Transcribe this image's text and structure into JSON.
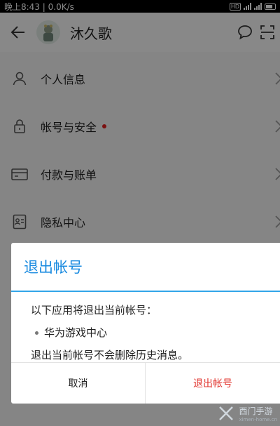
{
  "status_bar": {
    "time_net": "晚上8:43 | 0.0K/s",
    "hd_badge": "HD"
  },
  "app_bar": {
    "user_name": "沐久歌"
  },
  "menu": {
    "items": [
      {
        "label": "个人信息",
        "icon": "person-icon"
      },
      {
        "label": "帐号与安全",
        "icon": "lock-icon",
        "badge": "red-dot"
      },
      {
        "label": "付款与账单",
        "icon": "card-icon"
      },
      {
        "label": "隐私中心",
        "icon": "id-card-icon"
      }
    ]
  },
  "dialog": {
    "title": "退出帐号",
    "intro": "以下应用将退出当前帐号：",
    "app_item": "华为游戏中心",
    "note": "退出当前帐号不会删除历史消息。",
    "cancel_label": "取消",
    "logout_label": "退出帐号"
  },
  "watermark": {
    "title": "西门手游",
    "subtitle": "ximen-home.cn"
  },
  "colors": {
    "accent": "#1a8be0",
    "danger": "#e0302a",
    "badge": "#e02020"
  }
}
